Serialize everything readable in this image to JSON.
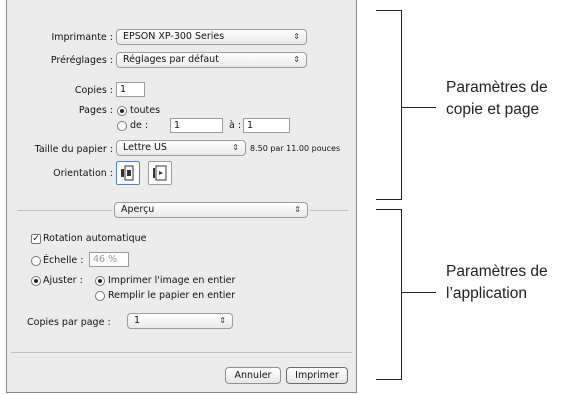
{
  "dialog": {
    "printer_label": "Imprimante :",
    "printer_value": "EPSON XP-300 Series",
    "presets_label": "Préréglages :",
    "presets_value": "Réglages par défaut",
    "copies_label": "Copies :",
    "copies_value": "1",
    "pages_label": "Pages :",
    "pages_all": "toutes",
    "pages_from": "de :",
    "pages_from_value": "1",
    "pages_to": "à :",
    "pages_to_value": "1",
    "paper_label": "Taille du papier :",
    "paper_value": "Lettre US",
    "paper_dims": "8.50 par 11.00 pouces",
    "orientation_label": "Orientation :",
    "panel_value": "Aperçu",
    "auto_rotate": "Rotation automatique",
    "scale_label": "Échelle :",
    "scale_value": "46 %",
    "fit_label": "Ajuster :",
    "fit_print_whole": "Imprimer l'image en entier",
    "fit_fill_paper": "Remplir le papier en entier",
    "copies_per_page_label": "Copies par page :",
    "copies_per_page_value": "1",
    "cancel_button": "Annuler",
    "print_button": "Imprimer"
  },
  "annotations": {
    "top_line1": "Paramètres de",
    "top_line2": "copie et page",
    "bottom_line1": "Paramètres de",
    "bottom_line2": "l’application"
  },
  "icons": {
    "popup_arrow": "updown-arrows-icon",
    "portrait": "portrait-orientation-icon",
    "landscape": "landscape-orientation-icon"
  }
}
